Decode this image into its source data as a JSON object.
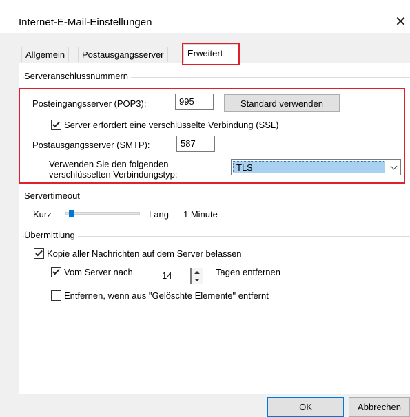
{
  "window": {
    "title": "Internet-E-Mail-Einstellungen",
    "close_glyph": "✕"
  },
  "tabs": [
    {
      "label": "Allgemein",
      "active": false
    },
    {
      "label": "Postausgangsserver",
      "active": false
    },
    {
      "label": "Erweitert",
      "active": true
    }
  ],
  "server_ports": {
    "group_title": "Serveranschlussnummern",
    "incoming_label": "Posteingangsserver (POP3):",
    "incoming_port": "995",
    "default_button": "Standard verwenden",
    "ssl_checkbox_label": "Server erfordert eine verschlüsselte Verbindung (SSL)",
    "ssl_checked": true,
    "outgoing_label": "Postausgangsserver (SMTP):",
    "outgoing_port": "587",
    "encryption_label_line1": "Verwenden Sie den folgenden",
    "encryption_label_line2": "verschlüsselten Verbindungstyp:",
    "encryption_value": "TLS"
  },
  "timeout": {
    "group_title": "Servertimeout",
    "short_label": "Kurz",
    "long_label": "Lang",
    "value_label": "1 Minute",
    "slider_fraction": 0.05
  },
  "delivery": {
    "group_title": "Übermittlung",
    "keep_copy_label": "Kopie aller Nachrichten auf dem Server belassen",
    "keep_copy_checked": true,
    "remove_after_label_pre": "Vom Server nach",
    "remove_after_days": "14",
    "remove_after_label_post": "Tagen entfernen",
    "remove_after_checked": true,
    "remove_deleted_label": "Entfernen, wenn aus \"Gelöschte Elemente\" entfernt",
    "remove_deleted_checked": false
  },
  "footer": {
    "ok_label": "OK",
    "cancel_label": "Abbrechen"
  },
  "colors": {
    "highlight_red": "#e0202a",
    "selection_blue": "#a8d0f0",
    "slider_blue": "#0078d7"
  }
}
